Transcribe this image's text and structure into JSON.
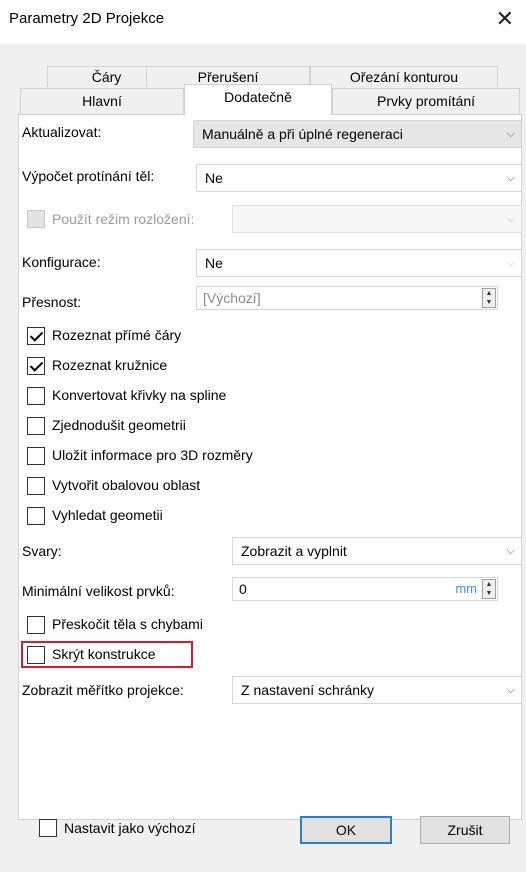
{
  "window": {
    "title": "Parametry 2D Projekce",
    "close_glyph": "✕"
  },
  "tabs": {
    "row1": [
      "Čáry",
      "Přerušení",
      "Ořezání konturou"
    ],
    "row2": [
      "Hlavní",
      "Dodatečně",
      "Prvky promítání"
    ],
    "active": "Dodatečně"
  },
  "fields": {
    "aktualizovat": {
      "label": "Aktualizovat:",
      "value": "Manuálně a při úplné regeneraci"
    },
    "vypocet": {
      "label": "Výpočet protínání těl:",
      "value": "Ne"
    },
    "rezim": {
      "label": "Použít režim rozložení:",
      "value": "",
      "checked": false,
      "enabled": false
    },
    "konfigurace": {
      "label": "Konfigurace:",
      "value": "Ne"
    },
    "presnost": {
      "label": "Přesnost:",
      "placeholder": "[Výchozí]"
    },
    "svary": {
      "label": "Svary:",
      "value": "Zobrazit a vyplnit"
    },
    "min_velikost": {
      "label": "Minimální velikost prvků:",
      "value": "0",
      "unit": "mm"
    },
    "meritko": {
      "label": "Zobrazit měřítko projekce:",
      "value": "Z nastavení schránky"
    }
  },
  "checkboxes": [
    {
      "label": "Rozeznat přímé čáry",
      "checked": true
    },
    {
      "label": "Rozeznat kružnice",
      "checked": true
    },
    {
      "label": "Konvertovat křivky na spline",
      "checked": false
    },
    {
      "label": "Zjednodušit geometrii",
      "checked": false
    },
    {
      "label": "Uložit informace pro 3D rozměry",
      "checked": false
    },
    {
      "label": "Vytvořit obalovou oblast",
      "checked": false
    },
    {
      "label": "Vyhledat geometii",
      "checked": false
    },
    {
      "label": "Přeskočit těla s chybami",
      "checked": false
    },
    {
      "label": "Skrýt konstrukce",
      "checked": false
    }
  ],
  "footer": {
    "default_checkbox": {
      "label": "Nastavit jako výchozí",
      "checked": false
    },
    "ok": "OK",
    "cancel": "Zrušit"
  },
  "colors": {
    "highlight": "#cc1f2f",
    "default_button_border": "#2c7fd0",
    "unit_text": "#4a90d9"
  }
}
